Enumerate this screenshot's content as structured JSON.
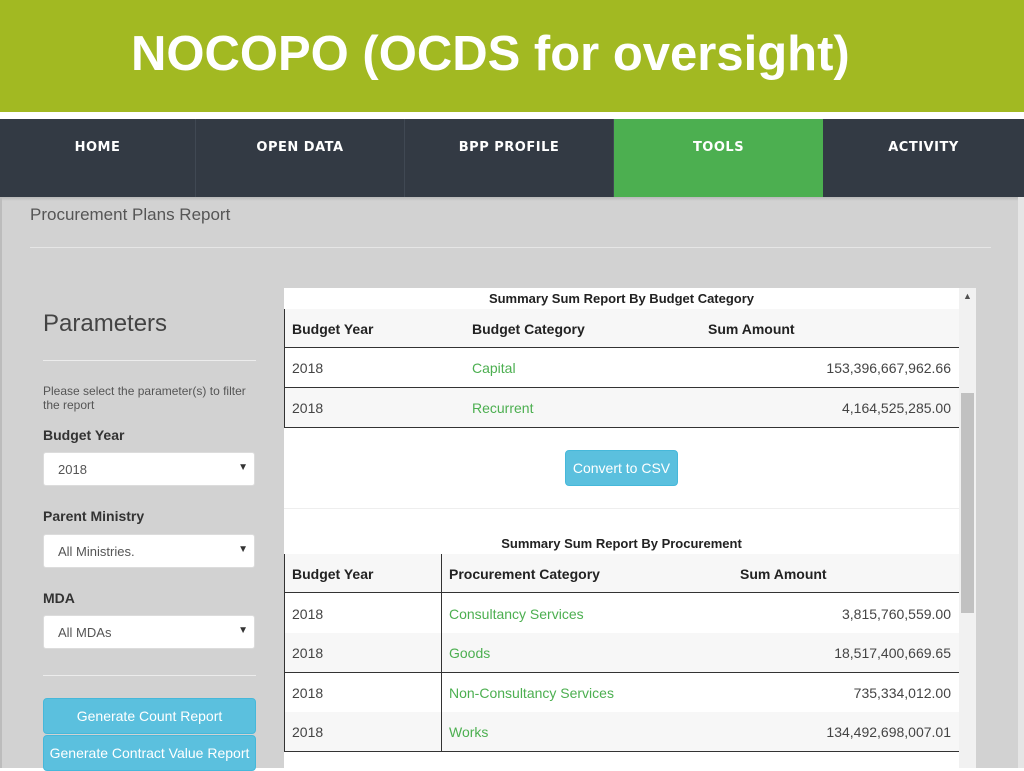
{
  "banner": {
    "title": "NOCOPO (OCDS for oversight)",
    "color": "#a2b922"
  },
  "nav": {
    "items": [
      {
        "label": "HOME",
        "active": false
      },
      {
        "label": "OPEN DATA",
        "active": false
      },
      {
        "label": "BPP PROFILE",
        "active": false
      },
      {
        "label": "TOOLS",
        "active": true
      },
      {
        "label": "ACTIVITY",
        "active": false
      }
    ],
    "active_color": "#4caf50"
  },
  "page": {
    "title": "Procurement Plans Report"
  },
  "parameters": {
    "title": "Parameters",
    "help": "Please select the parameter(s) to filter the report",
    "budget_year": {
      "label": "Budget Year",
      "value": "2018"
    },
    "parent_ministry": {
      "label": "Parent Ministry",
      "value": "All Ministries."
    },
    "mda": {
      "label": "MDA",
      "value": "All MDAs"
    },
    "buttons": {
      "count_report": "Generate Count Report",
      "contract_value_report": "Generate Contract Value Report"
    }
  },
  "budget_category_table": {
    "caption": "Summary Sum Report By Budget Category",
    "headers": [
      "Budget Year",
      "Budget Category",
      "Sum Amount"
    ],
    "rows": [
      {
        "year": "2018",
        "category": "Capital",
        "amount": "153,396,667,962.66"
      },
      {
        "year": "2018",
        "category": "Recurrent",
        "amount": "4,164,525,285.00"
      }
    ]
  },
  "convert_csv": "Convert to CSV",
  "procurement_table": {
    "caption": "Summary Sum Report By Procurement",
    "headers": [
      "Budget Year",
      "Procurement Category",
      "Sum Amount"
    ],
    "rows": [
      {
        "year": "2018",
        "category": "Consultancy Services",
        "amount": "3,815,760,559.00"
      },
      {
        "year": "2018",
        "category": "Goods",
        "amount": "18,517,400,669.65"
      },
      {
        "year": "2018",
        "category": "Non-Consultancy Services",
        "amount": "735,334,012.00"
      },
      {
        "year": "2018",
        "category": "Works",
        "amount": "134,492,698,007.01"
      }
    ]
  },
  "icons": {
    "select_arrow": "dropdown-arrow-icon",
    "scroll_up": "scroll-up-arrow-icon"
  }
}
